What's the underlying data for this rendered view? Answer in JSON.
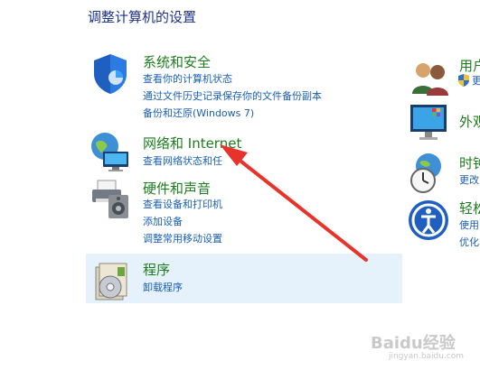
{
  "page_title": "调整计算机的设置",
  "categories": [
    {
      "title": "系统和安全",
      "links": [
        "查看你的计算机状态",
        "通过文件历史记录保存你的文件备份副本",
        "备份和还原(Windows 7)"
      ]
    },
    {
      "title": "网络和 Internet",
      "links": [
        "查看网络状态和任"
      ]
    },
    {
      "title": "硬件和声音",
      "links": [
        "查看设备和打印机",
        "添加设备",
        "调整常用移动设置"
      ]
    },
    {
      "title": "程序",
      "links": [
        "卸载程序"
      ]
    }
  ],
  "right_categories": [
    {
      "title": "用户",
      "links": [
        "更"
      ]
    },
    {
      "title": "外观",
      "links": []
    },
    {
      "title": "时钟",
      "links": [
        "更改"
      ]
    },
    {
      "title": "轻松",
      "links": [
        "使用",
        "优化"
      ]
    }
  ],
  "watermark": "Baidu经验",
  "watermark_url": "jingyan.baidu.com",
  "colors": {
    "annotation_arrow": "#e8332b",
    "category_title": "#1e7d1e",
    "link": "#1a5fb4",
    "highlight": "#e5f1fb"
  }
}
